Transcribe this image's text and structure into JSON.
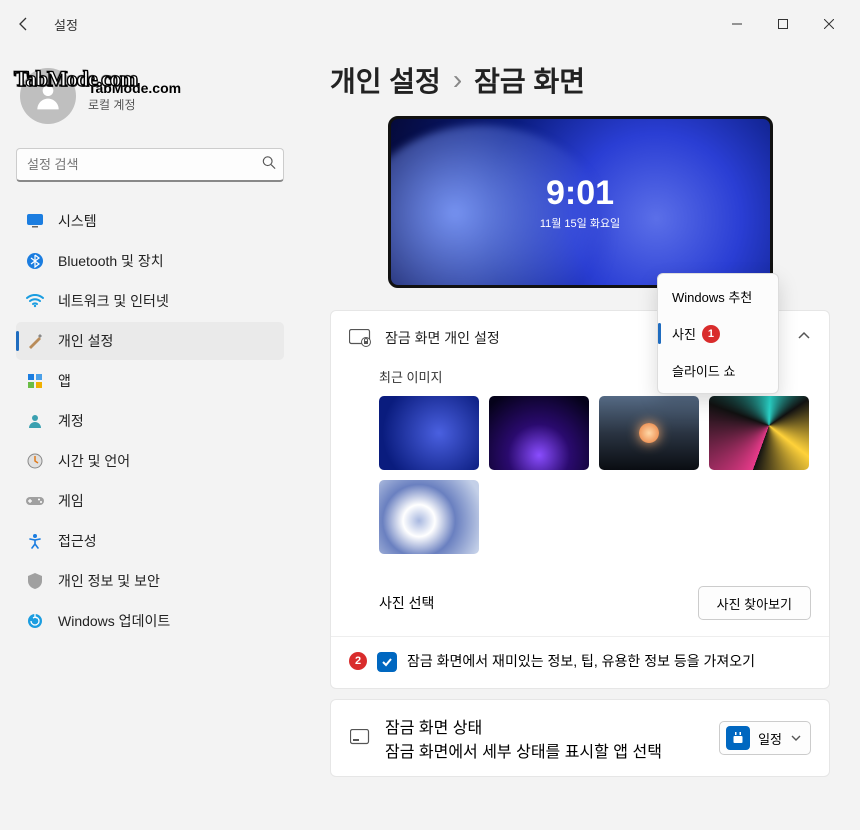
{
  "window": {
    "title": "설정"
  },
  "account": {
    "name": "TabMode.com",
    "sub": "로컬 계정",
    "watermark": "TabMode.com"
  },
  "search": {
    "placeholder": "설정 검색"
  },
  "nav": {
    "items": [
      {
        "label": "시스템"
      },
      {
        "label": "Bluetooth 및 장치"
      },
      {
        "label": "네트워크 및 인터넷"
      },
      {
        "label": "개인 설정"
      },
      {
        "label": "앱"
      },
      {
        "label": "계정"
      },
      {
        "label": "시간 및 언어"
      },
      {
        "label": "게임"
      },
      {
        "label": "접근성"
      },
      {
        "label": "개인 정보 및 보안"
      },
      {
        "label": "Windows 업데이트"
      }
    ]
  },
  "breadcrumb": {
    "a": "개인 설정",
    "b": "잠금 화면"
  },
  "preview": {
    "time": "9:01",
    "date": "11월 15일 화요일"
  },
  "section1": {
    "title": "잠금 화면 개인 설정",
    "dropdown": {
      "opt0": "Windows 추천",
      "opt1": "사진",
      "opt2": "슬라이드 쇼"
    },
    "badge1": "1",
    "recent_label": "최근 이미지",
    "choose_label": "사진 선택",
    "browse_btn": "사진 찾아보기"
  },
  "section2": {
    "badge": "2",
    "text": "잠금 화면에서 재미있는 정보, 팁, 유용한 정보 등을 가져오기"
  },
  "section3": {
    "title": "잠금 화면 상태",
    "sub": "잠금 화면에서 세부 상태를 표시할 앱 선택",
    "app": "일정"
  }
}
